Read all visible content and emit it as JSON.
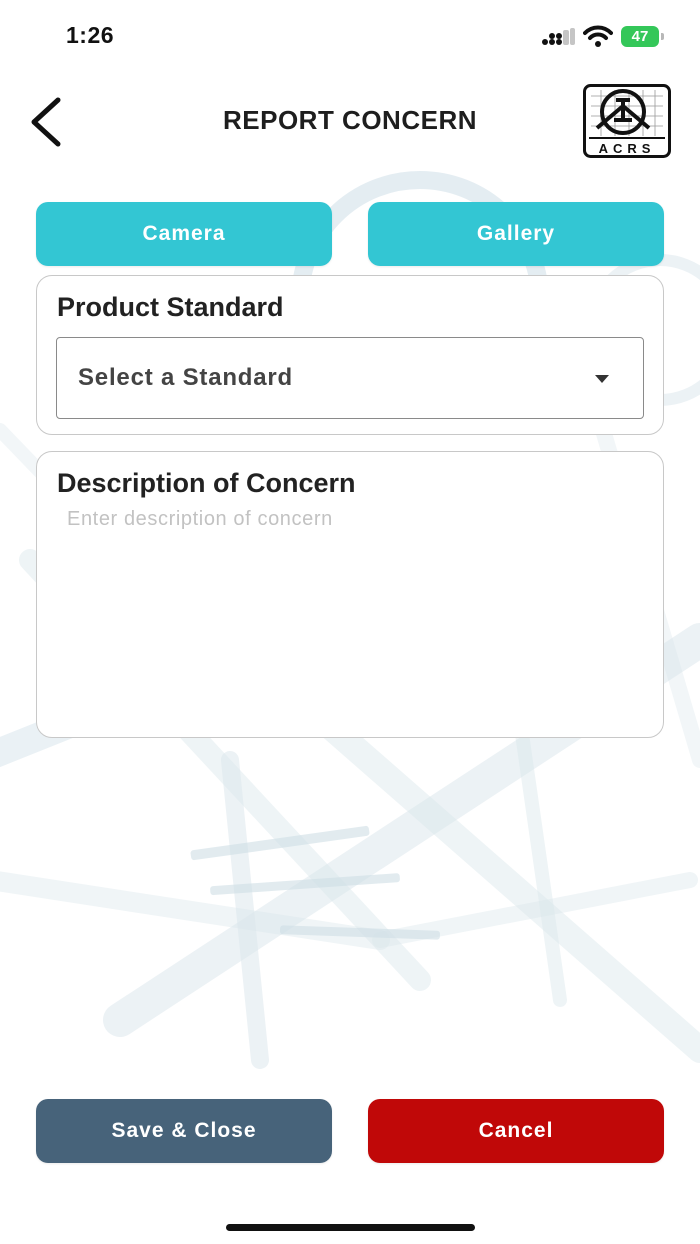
{
  "status_bar": {
    "time": "1:26",
    "battery_level": "47"
  },
  "header": {
    "title": "REPORT CONCERN",
    "logo_text": "ACRS"
  },
  "media_buttons": {
    "camera_label": "Camera",
    "gallery_label": "Gallery"
  },
  "product_standard": {
    "label": "Product Standard",
    "selected_value": "Select a Standard"
  },
  "description": {
    "label": "Description of Concern",
    "placeholder": "Enter description of concern",
    "value": ""
  },
  "footer": {
    "save_label": "Save & Close",
    "cancel_label": "Cancel"
  },
  "colors": {
    "accent_teal": "#33c6d3",
    "save_slate": "#47637a",
    "cancel_red": "#c00808",
    "battery_green": "#34c759"
  }
}
